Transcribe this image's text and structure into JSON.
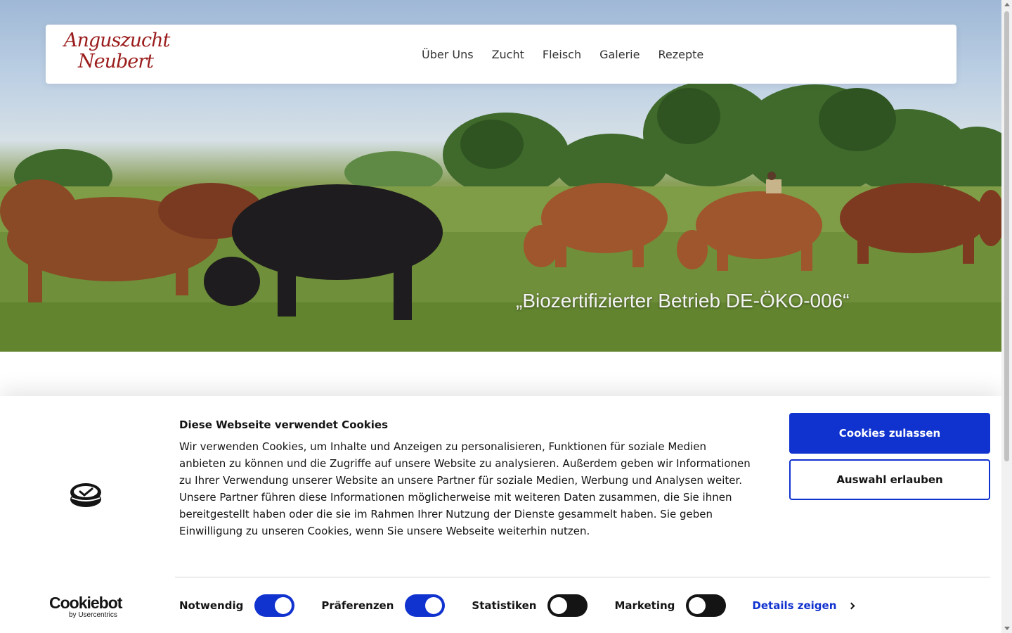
{
  "site": {
    "logo": {
      "line1": "Anguszucht",
      "line2": "Neubert"
    },
    "nav": [
      {
        "label": "Über Uns"
      },
      {
        "label": "Zucht"
      },
      {
        "label": "Fleisch"
      },
      {
        "label": "Galerie"
      },
      {
        "label": "Rezepte"
      }
    ]
  },
  "hero": {
    "caption": "„Biozertifizierter Betrieb DE-ÖKO-006“"
  },
  "cookie_banner": {
    "title": "Diese Webseite verwendet Cookies",
    "text": "Wir verwenden Cookies, um Inhalte und Anzeigen zu personalisieren, Funktionen für soziale Medien anbieten zu können und die Zugriffe auf unsere Website zu analysieren. Außerdem geben wir Informationen zu Ihrer Verwendung unserer Website an unsere Partner für soziale Medien, Werbung und Analysen weiter. Unsere Partner führen diese Informationen möglicherweise mit weiteren Daten zusammen, die Sie ihnen bereitgestellt haben oder die sie im Rahmen Ihrer Nutzung der Dienste gesammelt haben. Sie geben Einwilligung zu unseren Cookies, wenn Sie unsere Webseite weiterhin nutzen.",
    "allow_all_label": "Cookies zulassen",
    "allow_selection_label": "Auswahl erlauben",
    "toggles": [
      {
        "label": "Notwendig",
        "on": true
      },
      {
        "label": "Präferenzen",
        "on": true
      },
      {
        "label": "Statistiken",
        "on": false
      },
      {
        "label": "Marketing",
        "on": false
      }
    ],
    "details_label": "Details zeigen",
    "brand": {
      "name": "Cookiebot",
      "sub": "by Usercentrics"
    }
  },
  "colors": {
    "accent": "#1032cf",
    "logo": "#9b1c1c",
    "toggle_off": "#141414"
  }
}
